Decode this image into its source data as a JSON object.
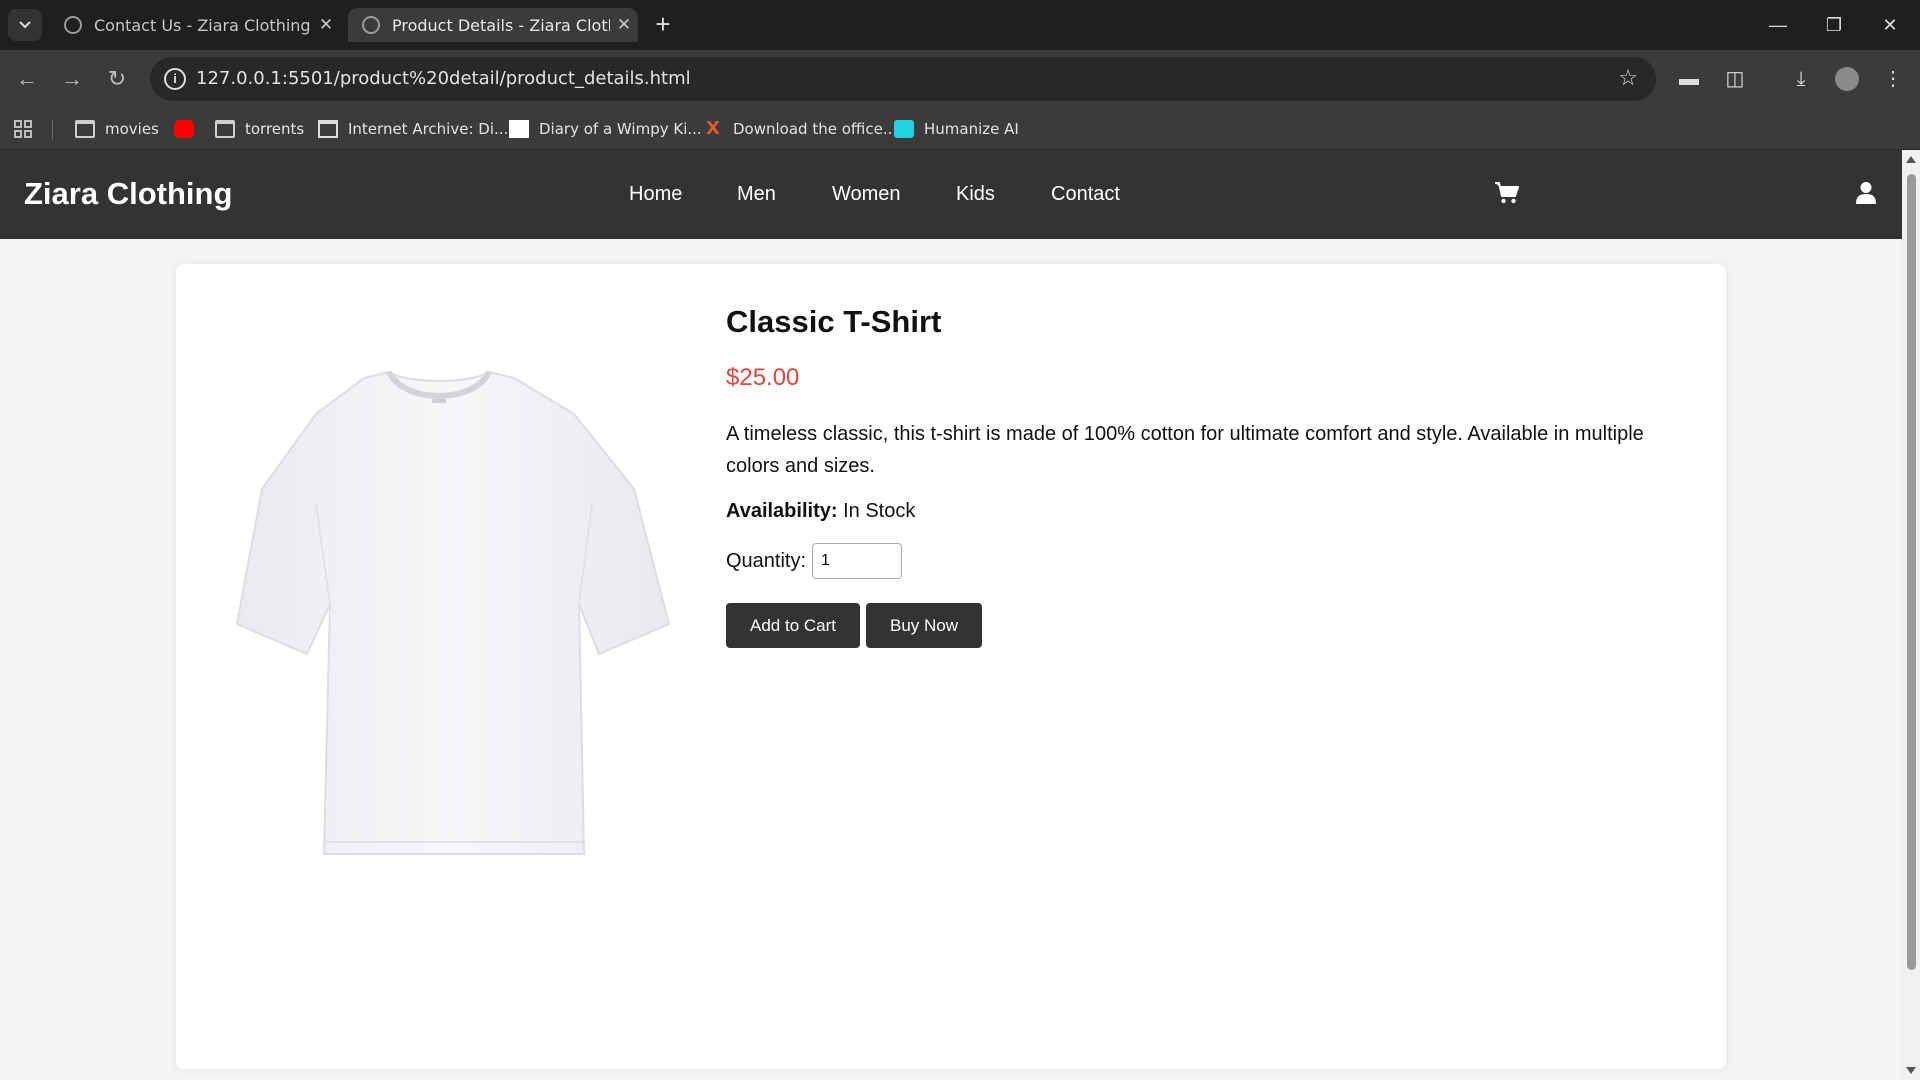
{
  "browser": {
    "tabs": [
      {
        "title": "Contact Us - Ziara Clothing",
        "active": false
      },
      {
        "title": "Product Details - Ziara Clothing",
        "active": true
      }
    ],
    "new_tab_symbol": "+",
    "url": "127.0.0.1:5501/product%20detail/product_details.html",
    "bookmarks": [
      {
        "label": "movies",
        "icon": "folder-icon"
      },
      {
        "label": "",
        "icon": "youtube-icon"
      },
      {
        "label": "torrents",
        "icon": "folder-icon"
      },
      {
        "label": "Internet Archive: Di...",
        "icon": "archive-icon"
      },
      {
        "label": "Diary of a Wimpy Ki...",
        "icon": "page-icon"
      },
      {
        "label": "Download the office...",
        "icon": "x-icon"
      },
      {
        "label": "Humanize AI",
        "icon": "humanize-icon"
      }
    ]
  },
  "site": {
    "brand": "Ziara Clothing",
    "nav": [
      "Home",
      "Men",
      "Women",
      "Kids",
      "Contact"
    ],
    "icons": {
      "cart": "cart-icon",
      "user": "user-icon"
    }
  },
  "product": {
    "title": "Classic T-Shirt",
    "price": "$25.00",
    "description": "A timeless classic, this t-shirt is made of 100% cotton for ultimate comfort and style. Available in multiple colors and sizes.",
    "availability_label": "Availability:",
    "availability_value": "In Stock",
    "quantity_label": "Quantity:",
    "quantity_value": "1",
    "add_to_cart": "Add to Cart",
    "buy_now": "Buy Now"
  },
  "colors": {
    "header_bg": "#333333",
    "price": "#e0463a",
    "button_bg": "#333333"
  }
}
